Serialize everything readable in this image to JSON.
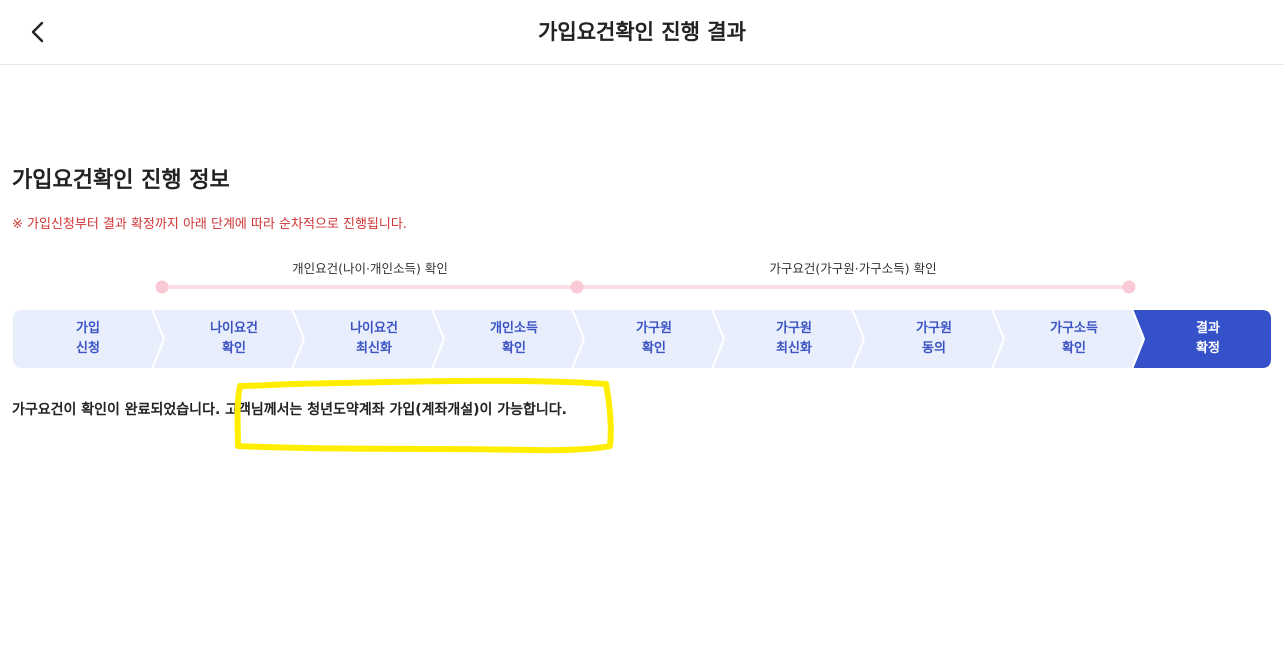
{
  "header": {
    "title": "가입요건확인 진행 결과"
  },
  "section": {
    "title": "가입요건확인 진행 정보",
    "notice": "※ 가입신청부터 결과 확정까지 아래 단계에 따라 순차적으로 진행됩니다."
  },
  "groups": [
    {
      "label": "개인요건(나이·개인소득) 확인"
    },
    {
      "label": "가구요건(가구원·가구소득) 확인"
    }
  ],
  "steps": [
    {
      "label": "가입\n신청",
      "active": false
    },
    {
      "label": "나이요건\n확인",
      "active": false
    },
    {
      "label": "나이요건\n최신화",
      "active": false
    },
    {
      "label": "개인소득\n확인",
      "active": false
    },
    {
      "label": "가구원\n확인",
      "active": false
    },
    {
      "label": "가구원\n최신화",
      "active": false
    },
    {
      "label": "가구원\n동의",
      "active": false
    },
    {
      "label": "가구소득\n확인",
      "active": false
    },
    {
      "label": "결과\n확정",
      "active": true
    }
  ],
  "result": {
    "text_part1": "가구요건이 확인이 완료되었습니다.",
    "text_part2": " 고객님께서는 청년도약계좌 가입(계좌개설)이 가능합니다."
  },
  "colors": {
    "step_bg": "#e9eefc",
    "step_active_bg": "#3451c9",
    "step_text": "#3b54c4",
    "timeline": "#fbdde6",
    "timeline_dot": "#f9c9d6",
    "notice": "#d03535",
    "highlight": "#ffee00"
  },
  "icons": {
    "back": "chevron-left-icon"
  }
}
